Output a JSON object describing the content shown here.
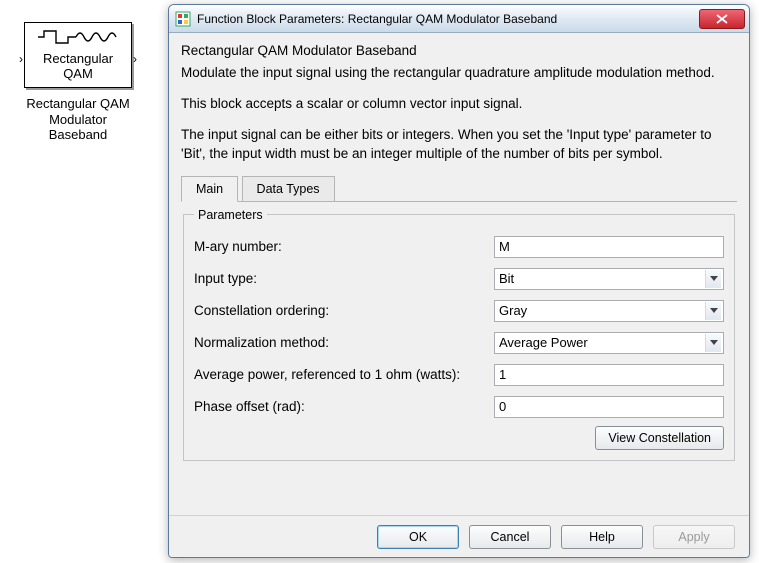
{
  "simulink": {
    "block_line1": "Rectangular",
    "block_line2": "QAM",
    "caption_l1": "Rectangular QAM",
    "caption_l2": "Modulator",
    "caption_l3": "Baseband"
  },
  "dialog": {
    "title": "Function Block Parameters: Rectangular QAM Modulator Baseband",
    "heading": "Rectangular QAM Modulator Baseband",
    "desc1": "Modulate the input signal using the rectangular quadrature amplitude modulation method.",
    "desc2": "This block accepts a scalar or column vector input signal.",
    "desc3": "The input signal can be either bits or integers. When you set the 'Input type' parameter to 'Bit', the input width must be an integer multiple of the number of bits per symbol."
  },
  "tabs": {
    "main": "Main",
    "datatypes": "Data Types"
  },
  "params": {
    "legend": "Parameters",
    "mary_label": "M-ary number:",
    "mary_value": "M",
    "inputtype_label": "Input type:",
    "inputtype_value": "Bit",
    "constorder_label": "Constellation ordering:",
    "constorder_value": "Gray",
    "norm_label": "Normalization method:",
    "norm_value": "Average Power",
    "avgpower_label": "Average power, referenced to 1 ohm (watts):",
    "avgpower_value": "1",
    "phase_label": "Phase offset (rad):",
    "phase_value": "0",
    "view_const": "View Constellation"
  },
  "buttons": {
    "ok": "OK",
    "cancel": "Cancel",
    "help": "Help",
    "apply": "Apply"
  }
}
